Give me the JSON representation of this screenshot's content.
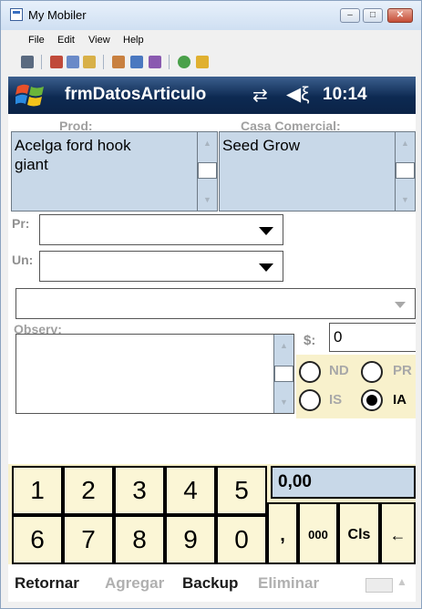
{
  "window": {
    "title": "My Mobiler",
    "menu": [
      "File",
      "Edit",
      "View",
      "Help"
    ],
    "controls": {
      "minimize": "–",
      "maximize": "□",
      "close": "✕"
    }
  },
  "device": {
    "form_title": "frmDatosArticulo",
    "status": {
      "connectivity_icon": "connection-arrows-icon",
      "volume_icon": "speaker-icon",
      "time": "10:14"
    },
    "fields": {
      "prod_label": "Prod:",
      "prod_value_line1": "Acelga ford hook",
      "prod_value_line2": "giant",
      "casa_label": "Casa Comercial:",
      "casa_value": "Seed Grow",
      "pr_label": "Pr:",
      "un_label": "Un:",
      "observ_label": "Observ:",
      "dollar_label": "$:",
      "amount_value": "0"
    },
    "radios": [
      {
        "label": "ND",
        "selected": false
      },
      {
        "label": "PR",
        "selected": false
      },
      {
        "label": "IS",
        "selected": false
      },
      {
        "label": "IA",
        "selected": true
      }
    ],
    "keypad": {
      "row1": [
        "1",
        "2",
        "3",
        "4",
        "5"
      ],
      "row2": [
        "6",
        "7",
        "8",
        "9",
        "0"
      ],
      "extra": [
        ",",
        "000",
        "Cls",
        "←"
      ],
      "display": "0,00"
    },
    "softkeys": {
      "retornar": "Retornar",
      "agregar": "Agregar",
      "backup": "Backup",
      "eliminar": "Eliminar"
    },
    "colors": {
      "title_bar": "#0d2a52",
      "textbox_bg": "#c8d8e8",
      "keypad_bg": "#fbf6d6",
      "disabled_text": "#b0b0b0"
    }
  }
}
